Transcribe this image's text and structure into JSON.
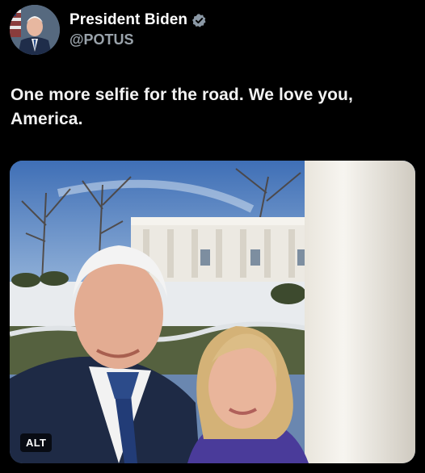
{
  "post": {
    "display_name": "President Biden",
    "handle": "@POTUS",
    "verified": true,
    "verified_icon": "verified-badge-icon",
    "text": "One more selfie for the road. We love you, America."
  },
  "media": {
    "alt_label": "ALT"
  },
  "colors": {
    "background": "#000000",
    "verified_badge": "#8b98a5",
    "handle": "#9aa3ab"
  }
}
